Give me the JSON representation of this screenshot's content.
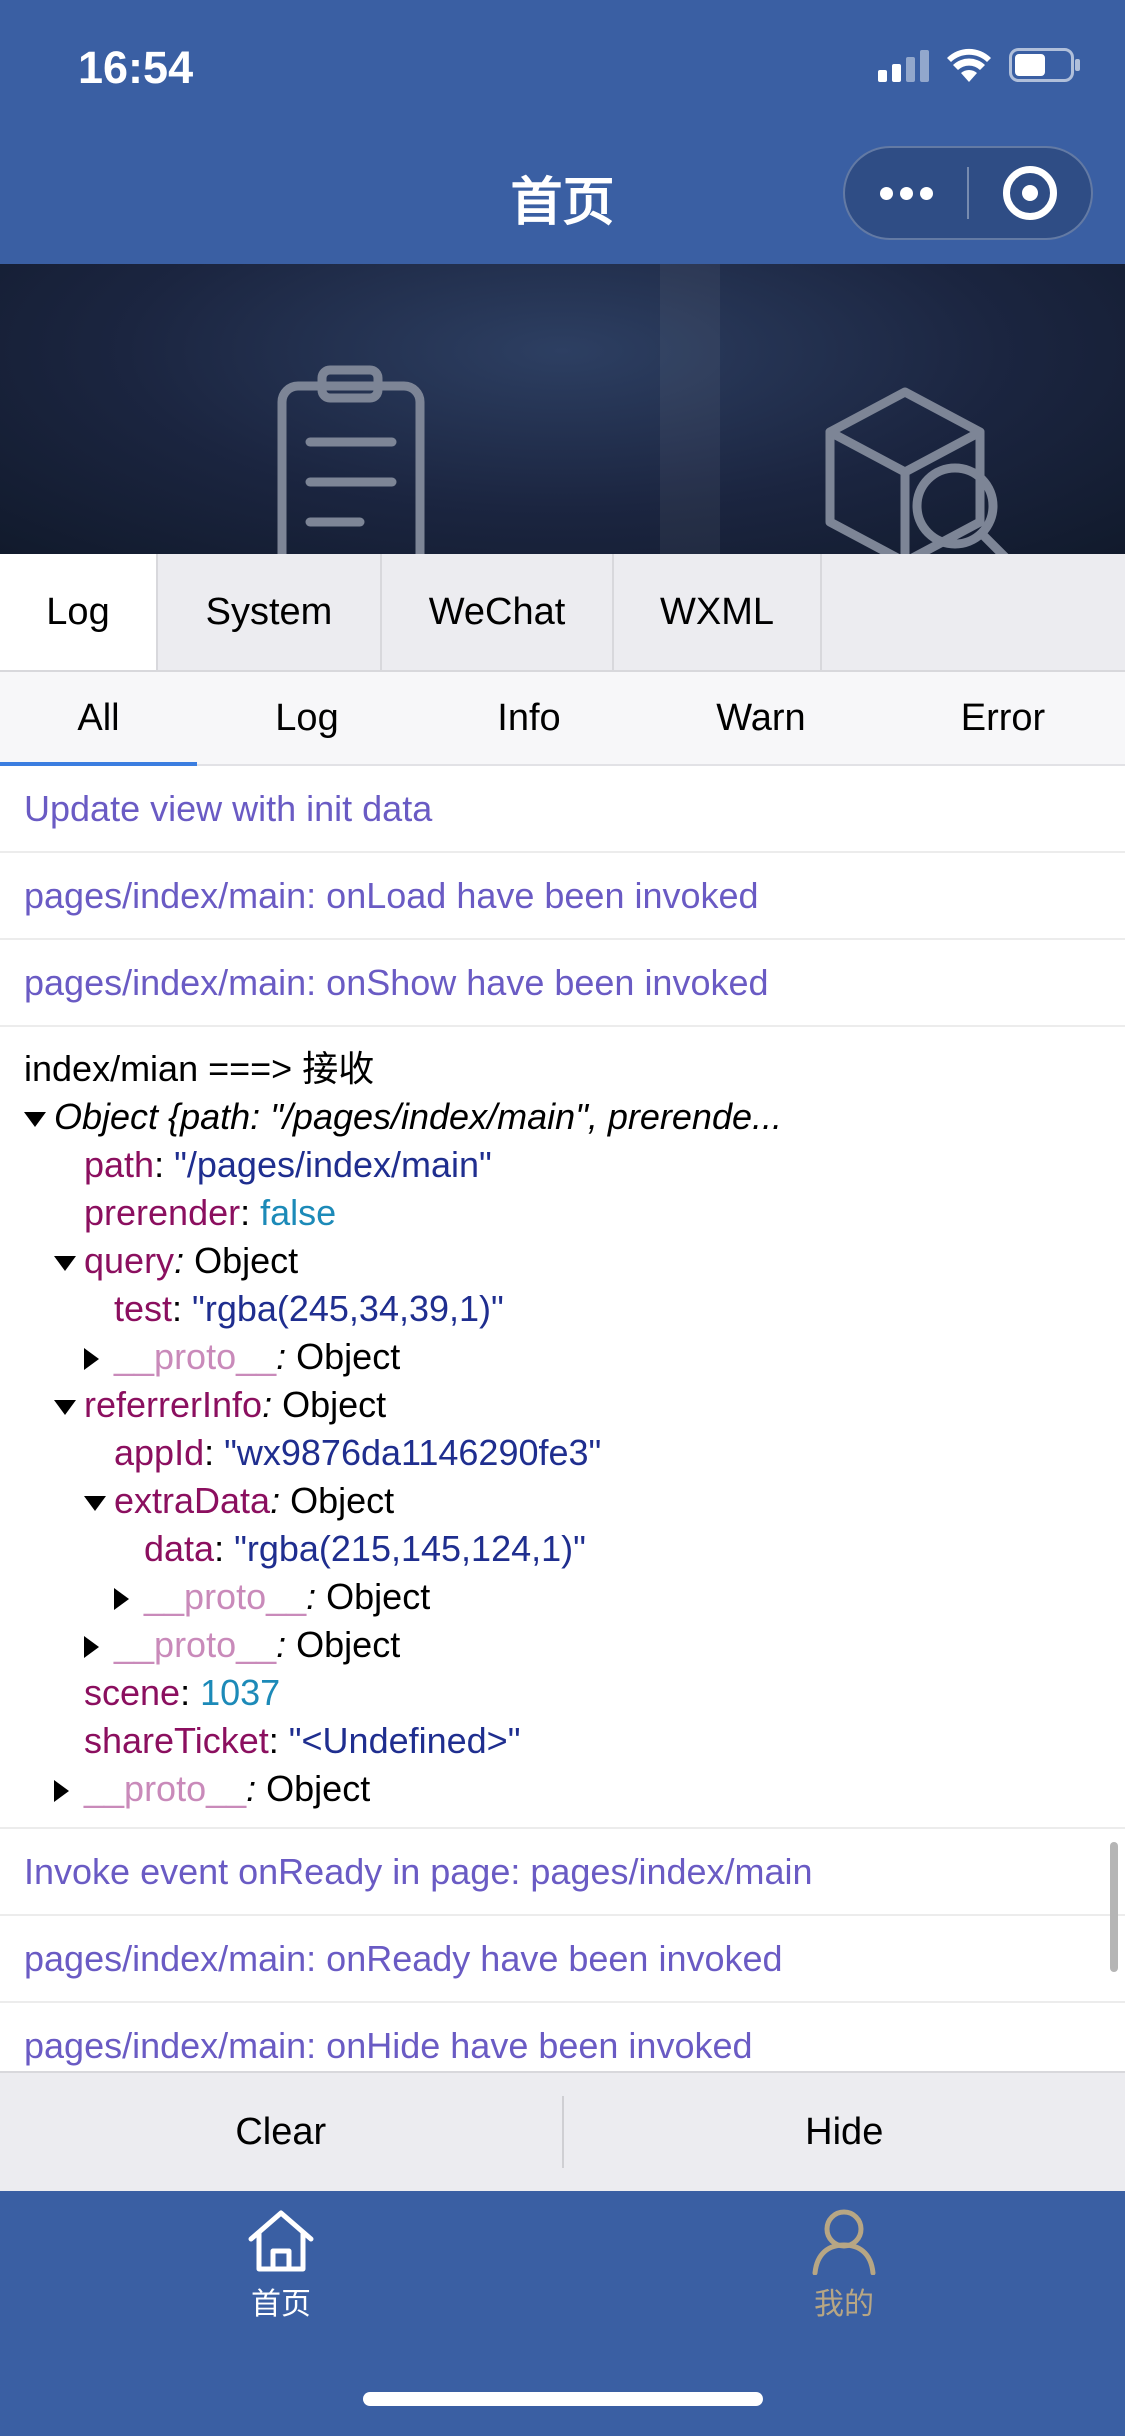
{
  "status": {
    "time": "16:54"
  },
  "nav": {
    "title": "首页"
  },
  "colors": {
    "header_blue": "#3a5fa3",
    "log_purple": "#6a5bc4",
    "key_color": "#8b0f5f",
    "string_color": "#1f2e8f",
    "number_color": "#1c8ab8",
    "tab_active": "#3b7ee0"
  },
  "panel_tabs": [
    {
      "label": "Log",
      "active": true
    },
    {
      "label": "System",
      "active": false
    },
    {
      "label": "WeChat",
      "active": false
    },
    {
      "label": "WXML",
      "active": false
    }
  ],
  "level_tabs": [
    {
      "label": "All",
      "active": true
    },
    {
      "label": "Log",
      "active": false
    },
    {
      "label": "Info",
      "active": false
    },
    {
      "label": "Warn",
      "active": false
    },
    {
      "label": "Error",
      "active": false
    }
  ],
  "logs": {
    "l1": "Update view with init data",
    "l2": "pages/index/main: onLoad have been invoked",
    "l3": "pages/index/main: onShow have been invoked",
    "l4": "Invoke event onReady in page: pages/index/main",
    "l5": "pages/index/main: onReady have been invoked",
    "l6": "pages/index/main: onHide have been invoked"
  },
  "object_log": {
    "header": "index/mian ===> 接收",
    "summary": "Object {path: \"/pages/index/main\", prerende...",
    "path_key": "path",
    "path_val": "\"/pages/index/main\"",
    "prerender_key": "prerender",
    "prerender_val": "false",
    "query_key": "query",
    "object_word": "Object",
    "test_key": "test",
    "test_val": "\"rgba(245,34,39,1)\"",
    "proto_key": "__proto__",
    "referrer_key": "referrerInfo",
    "appid_key": "appId",
    "appid_val": "\"wx9876da1146290fe3\"",
    "extra_key": "extraData",
    "data_key": "data",
    "data_val": "\"rgba(215,145,124,1)\"",
    "scene_key": "scene",
    "scene_val": "1037",
    "ticket_key": "shareTicket",
    "ticket_val": "\"<Undefined>\""
  },
  "console_buttons": {
    "clear": "Clear",
    "hide": "Hide"
  },
  "tabbar": {
    "home": {
      "label": "首页",
      "icon": "home-icon"
    },
    "mine": {
      "label": "我的",
      "icon": "user-icon"
    }
  }
}
